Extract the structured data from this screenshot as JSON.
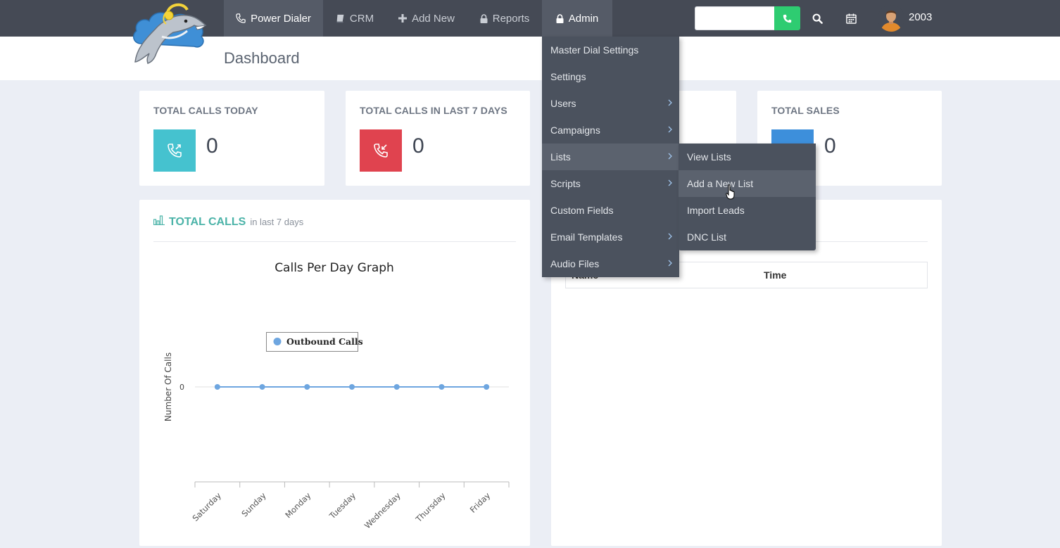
{
  "nav": {
    "power_dialer": "Power Dialer",
    "crm": "CRM",
    "add_new": "Add New",
    "reports": "Reports",
    "admin": "Admin"
  },
  "topbar": {
    "dial_placeholder": "",
    "user_extension": "2003"
  },
  "page_title": "Dashboard",
  "stats": [
    {
      "title": "TOTAL CALLS TODAY",
      "value": "0",
      "color": "#45c2cf",
      "icon": "phone-outgoing-icon"
    },
    {
      "title": "TOTAL CALLS IN LAST 7 DAYS",
      "value": "0",
      "color": "#e0434f",
      "icon": "phone-incoming-icon"
    },
    {
      "title": "",
      "value": "",
      "color": "#ffffff",
      "icon": ""
    },
    {
      "title": "TOTAL SALES",
      "value": "0",
      "color": "#3d8fdb",
      "icon": ""
    }
  ],
  "calls_panel": {
    "title": "TOTAL CALLS",
    "subtitle": "in last 7 days"
  },
  "right_panel": {
    "columns": [
      "Name",
      "Time"
    ]
  },
  "admin_menu": [
    {
      "label": "Master Dial Settings",
      "submenu": false
    },
    {
      "label": "Settings",
      "submenu": false
    },
    {
      "label": "Users",
      "submenu": true
    },
    {
      "label": "Campaigns",
      "submenu": true
    },
    {
      "label": "Lists",
      "submenu": true
    },
    {
      "label": "Scripts",
      "submenu": true
    },
    {
      "label": "Custom Fields",
      "submenu": false
    },
    {
      "label": "Email Templates",
      "submenu": true
    },
    {
      "label": "Audio Files",
      "submenu": true
    }
  ],
  "lists_menu": [
    {
      "label": "View Lists"
    },
    {
      "label": "Add a New List"
    },
    {
      "label": "Import Leads"
    },
    {
      "label": "DNC List"
    }
  ],
  "colors": {
    "topbar": "#454a55",
    "accent_green": "#2ecc71",
    "teal_title": "#4bb3a8",
    "series": "#6ea6e0"
  },
  "chart_data": {
    "type": "line",
    "title": "Calls Per Day Graph",
    "ylabel": "Number Of Calls",
    "xlabel": "",
    "categories": [
      "Saturday",
      "Sunday",
      "Monday",
      "Tuesday",
      "Wednesday",
      "Thursday",
      "Friday"
    ],
    "series": [
      {
        "name": "Outbound Calls",
        "values": [
          0,
          0,
          0,
          0,
          0,
          0,
          0
        ]
      }
    ],
    "yticks": [
      "0"
    ],
    "legend": "top-left",
    "grid": true
  }
}
